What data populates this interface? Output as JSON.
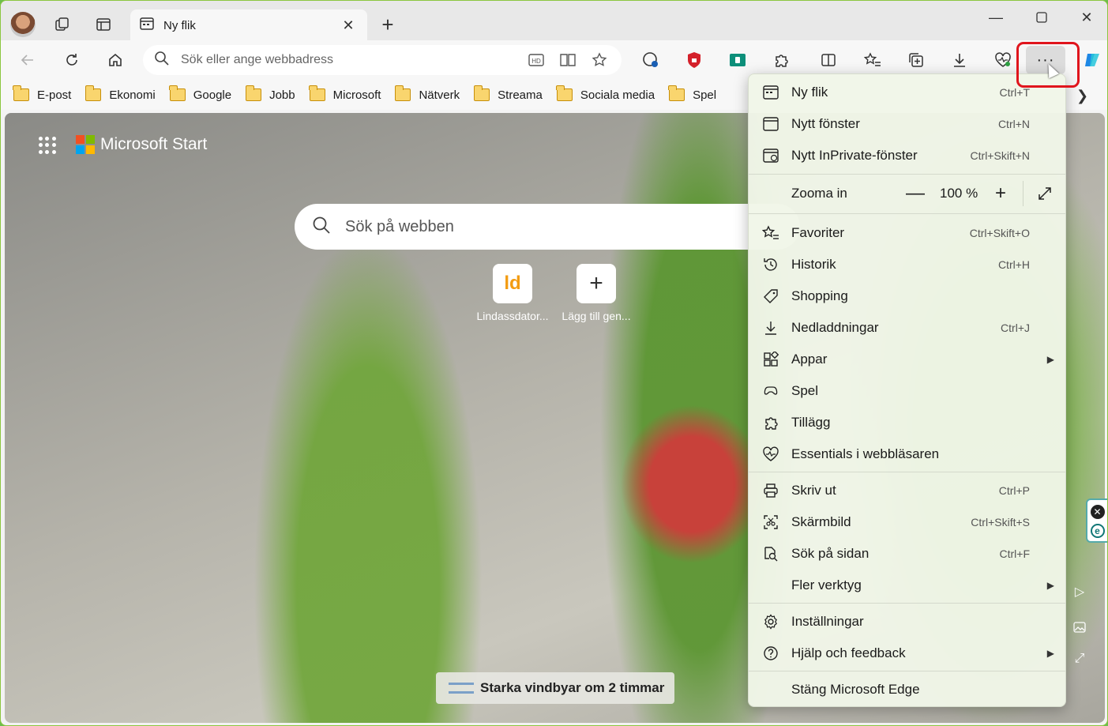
{
  "tab": {
    "title": "Ny flik"
  },
  "address_bar": {
    "placeholder": "Sök eller ange webbadress"
  },
  "favorites": [
    "E-post",
    "Ekonomi",
    "Google",
    "Jobb",
    "Microsoft",
    "Nätverk",
    "Streama",
    "Sociala media",
    "Spel"
  ],
  "page": {
    "brand": "Microsoft Start",
    "search_placeholder": "Sök på webben",
    "tiles": [
      {
        "icon_text": "ld",
        "label": "Lindassdator..."
      },
      {
        "icon_text": "+",
        "label": "Lägg till gen..."
      }
    ],
    "weather": "Starka vindbyar om 2 timmar"
  },
  "menu": {
    "items": [
      {
        "label": "Ny flik",
        "shortcut": "Ctrl+T",
        "icon": "new-tab-icon"
      },
      {
        "label": "Nytt fönster",
        "shortcut": "Ctrl+N",
        "icon": "new-window-icon"
      },
      {
        "label": "Nytt InPrivate-fönster",
        "shortcut": "Ctrl+Skift+N",
        "icon": "inprivate-icon"
      },
      {
        "label": "Favoriter",
        "shortcut": "Ctrl+Skift+O",
        "icon": "favorites-icon"
      },
      {
        "label": "Historik",
        "shortcut": "Ctrl+H",
        "icon": "history-icon"
      },
      {
        "label": "Shopping",
        "shortcut": "",
        "icon": "shopping-tag-icon"
      },
      {
        "label": "Nedladdningar",
        "shortcut": "Ctrl+J",
        "icon": "download-icon"
      },
      {
        "label": "Appar",
        "shortcut": "",
        "icon": "apps-icon"
      },
      {
        "label": "Spel",
        "shortcut": "",
        "icon": "games-icon"
      },
      {
        "label": "Tillägg",
        "shortcut": "",
        "icon": "extensions-icon"
      },
      {
        "label": "Essentials i webbläsaren",
        "shortcut": "",
        "icon": "heart-pulse-icon"
      },
      {
        "label": "Skriv ut",
        "shortcut": "Ctrl+P",
        "icon": "print-icon"
      },
      {
        "label": "Skärmbild",
        "shortcut": "Ctrl+Skift+S",
        "icon": "screenshot-icon"
      },
      {
        "label": "Sök på sidan",
        "shortcut": "Ctrl+F",
        "icon": "find-icon"
      },
      {
        "label": "Fler verktyg",
        "shortcut": "",
        "icon": ""
      },
      {
        "label": "Inställningar",
        "shortcut": "",
        "icon": "settings-icon"
      },
      {
        "label": "Hjälp och feedback",
        "shortcut": "",
        "icon": "help-icon"
      },
      {
        "label": "Stäng Microsoft Edge",
        "shortcut": "",
        "icon": ""
      }
    ],
    "zoom": {
      "label": "Zooma in",
      "value": "100 %",
      "minus": "—",
      "plus": "+"
    }
  },
  "more_button": {
    "label": "···"
  }
}
